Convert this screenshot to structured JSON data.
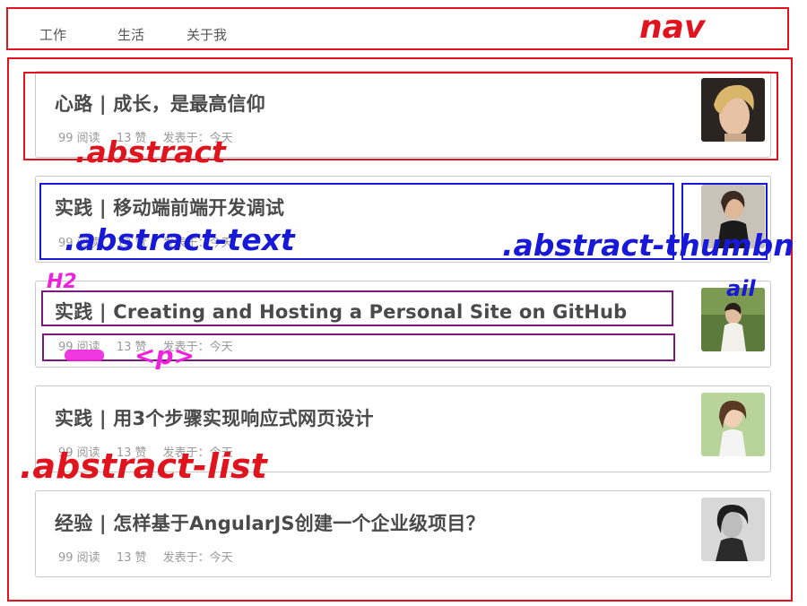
{
  "nav": {
    "items": [
      {
        "label": "工作"
      },
      {
        "label": "生活"
      },
      {
        "label": "关于我"
      }
    ]
  },
  "articles": [
    {
      "title": "心路 | 成长，是最高信仰",
      "reads": "99 阅读",
      "likes": "13 赞",
      "posted": "发表于：今天"
    },
    {
      "title": "实践 | 移动端前端开发调试",
      "reads": "99 阅读",
      "likes": "13 赞",
      "posted": "发表于：今天"
    },
    {
      "title": "实践 | Creating and Hosting a Personal Site on GitHub",
      "reads": "99 阅读",
      "likes": "13 赞",
      "posted": "发表于：今天"
    },
    {
      "title": "实践 | 用3个步骤实现响应式网页设计",
      "reads": "99 阅读",
      "likes": "13 赞",
      "posted": "发表于：今天"
    },
    {
      "title": "经验 | 怎样基于AngularJS创建一个企业级项目？",
      "reads": "99 阅读",
      "likes": "13 赞",
      "posted": "发表于：今天"
    }
  ],
  "annotations": {
    "nav": "nav",
    "abstract": ".abstract",
    "abstract_text": ".abstract-text",
    "abstract_thumbnail_line1": ".abstract-thumbn",
    "abstract_thumbnail_line2": "ail",
    "h2": "H2",
    "p": "<p>",
    "abstract_list": ".abstract-list"
  },
  "colors": {
    "annotation_red": "#e0141e",
    "annotation_blue": "#1818d8",
    "annotation_purple": "#7a1a7a",
    "annotation_magenta": "#ee22dd"
  }
}
